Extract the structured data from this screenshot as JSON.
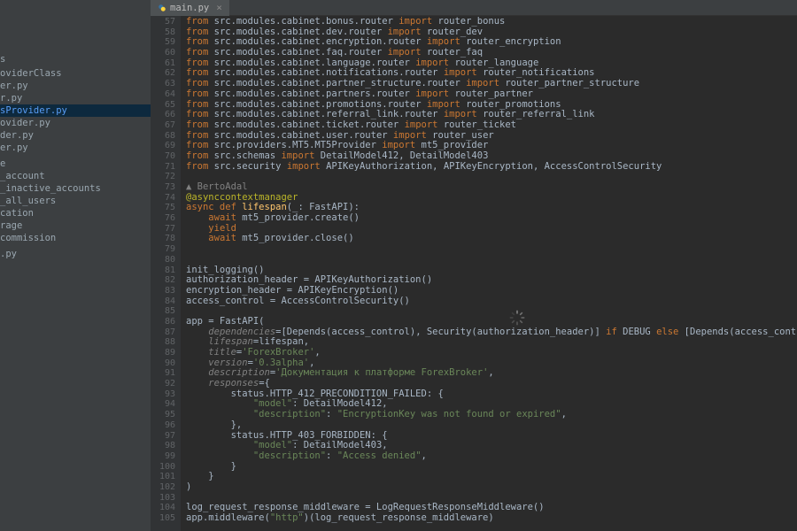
{
  "tab": {
    "filename": "main.py",
    "icon": "python-icon"
  },
  "sidebar": {
    "items": [
      "s",
      "",
      "oviderClass",
      "er.py",
      "r.py",
      "sProvider.py",
      "ovider.py",
      "der.py",
      "er.py",
      "",
      "",
      "e",
      "_account",
      "_inactive_accounts",
      "_all_users",
      "cation",
      "rage",
      "commission",
      "",
      "",
      ".py"
    ],
    "selected_index": 5
  },
  "gutter": {
    "start": 57,
    "end": 105,
    "fold_markers": [
      76,
      87,
      92,
      93,
      97
    ]
  },
  "author_hint": "BertoAdal",
  "code_lines": [
    {
      "n": 57,
      "pre": "",
      "t": [
        [
          "kw",
          "from"
        ],
        [
          "",
          " src.modules.cabinet.bonus.router "
        ],
        [
          "kw",
          "import"
        ],
        [
          "",
          " router_bonus"
        ]
      ]
    },
    {
      "n": 58,
      "pre": "",
      "t": [
        [
          "kw",
          "from"
        ],
        [
          "",
          " src.modules.cabinet.dev.router "
        ],
        [
          "kw",
          "import"
        ],
        [
          "",
          " router_dev"
        ]
      ]
    },
    {
      "n": 59,
      "pre": "",
      "t": [
        [
          "kw",
          "from"
        ],
        [
          "",
          " src.modules.cabinet.encryption.router "
        ],
        [
          "kw",
          "import"
        ],
        [
          "",
          " router_encryption"
        ]
      ]
    },
    {
      "n": 60,
      "pre": "",
      "t": [
        [
          "kw",
          "from"
        ],
        [
          "",
          " src.modules.cabinet.faq.router "
        ],
        [
          "kw",
          "import"
        ],
        [
          "",
          " router_faq"
        ]
      ]
    },
    {
      "n": 61,
      "pre": "",
      "t": [
        [
          "kw",
          "from"
        ],
        [
          "",
          " src.modules.cabinet.language.router "
        ],
        [
          "kw",
          "import"
        ],
        [
          "",
          " router_language"
        ]
      ]
    },
    {
      "n": 62,
      "pre": "",
      "t": [
        [
          "kw",
          "from"
        ],
        [
          "",
          " src.modules.cabinet.notifications.router "
        ],
        [
          "kw",
          "import"
        ],
        [
          "",
          " router_notifications"
        ]
      ]
    },
    {
      "n": 63,
      "pre": "",
      "t": [
        [
          "kw",
          "from"
        ],
        [
          "",
          " src.modules.cabinet.partner_structure.router "
        ],
        [
          "kw",
          "import"
        ],
        [
          "",
          " router_partner_structure"
        ]
      ]
    },
    {
      "n": 64,
      "pre": "",
      "t": [
        [
          "kw",
          "from"
        ],
        [
          "",
          " src.modules.cabinet.partners.router "
        ],
        [
          "kw",
          "import"
        ],
        [
          "",
          " router_partner"
        ]
      ]
    },
    {
      "n": 65,
      "pre": "",
      "t": [
        [
          "kw",
          "from"
        ],
        [
          "",
          " src.modules.cabinet.promotions.router "
        ],
        [
          "kw",
          "import"
        ],
        [
          "",
          " router_promotions"
        ]
      ]
    },
    {
      "n": 66,
      "pre": "",
      "t": [
        [
          "kw",
          "from"
        ],
        [
          "",
          " src.modules.cabinet.referral_link.router "
        ],
        [
          "kw",
          "import"
        ],
        [
          "",
          " router_referral_link"
        ]
      ]
    },
    {
      "n": 67,
      "pre": "",
      "t": [
        [
          "kw",
          "from"
        ],
        [
          "",
          " src.modules.cabinet.ticket.router "
        ],
        [
          "kw",
          "import"
        ],
        [
          "",
          " router_ticket"
        ]
      ]
    },
    {
      "n": 68,
      "pre": "",
      "t": [
        [
          "kw",
          "from"
        ],
        [
          "",
          " src.modules.cabinet.user.router "
        ],
        [
          "kw",
          "import"
        ],
        [
          "",
          " router_user"
        ]
      ]
    },
    {
      "n": 69,
      "pre": "",
      "t": [
        [
          "kw",
          "from"
        ],
        [
          "",
          " src.providers.MT5.MT5Provider "
        ],
        [
          "kw",
          "import"
        ],
        [
          "",
          " mt5_provider"
        ]
      ]
    },
    {
      "n": 70,
      "pre": "",
      "t": [
        [
          "kw",
          "from"
        ],
        [
          "",
          " src.schemas "
        ],
        [
          "kw",
          "import"
        ],
        [
          "",
          " DetailModel412, DetailModel403"
        ]
      ]
    },
    {
      "n": 71,
      "pre": "",
      "t": [
        [
          "kw",
          "from"
        ],
        [
          "",
          " src.security "
        ],
        [
          "kw",
          "import"
        ],
        [
          "",
          " APIKeyAuthorization, APIKeyEncryption, AccessControlSecurity"
        ]
      ]
    },
    {
      "n": 72,
      "pre": "",
      "t": [
        [
          "",
          ""
        ]
      ]
    },
    {
      "n": 73,
      "pre": "",
      "t": [
        [
          "",
          ""
        ]
      ],
      "author": true
    },
    {
      "n": 74,
      "pre": "",
      "t": [
        [
          "annot",
          "@asynccontextmanager"
        ]
      ]
    },
    {
      "n": 75,
      "pre": "",
      "t": [
        [
          "kw",
          "async def "
        ],
        [
          "fn",
          "lifespan"
        ],
        [
          "",
          "(_: FastAPI):"
        ]
      ]
    },
    {
      "n": 76,
      "pre": "    ",
      "t": [
        [
          "kw",
          "await"
        ],
        [
          "",
          " mt5_provider.create()"
        ]
      ]
    },
    {
      "n": 77,
      "pre": "    ",
      "t": [
        [
          "kw",
          "yield"
        ]
      ]
    },
    {
      "n": 78,
      "pre": "    ",
      "t": [
        [
          "kw",
          "await"
        ],
        [
          "",
          " mt5_provider.close()"
        ]
      ]
    },
    {
      "n": 79,
      "pre": "",
      "t": [
        [
          "",
          ""
        ]
      ]
    },
    {
      "n": 80,
      "pre": "",
      "t": [
        [
          "",
          ""
        ]
      ]
    },
    {
      "n": 81,
      "pre": "",
      "t": [
        [
          "",
          "init_logging()"
        ]
      ]
    },
    {
      "n": 82,
      "pre": "",
      "t": [
        [
          "",
          "authorization_header = APIKeyAuthorization()"
        ]
      ]
    },
    {
      "n": 83,
      "pre": "",
      "t": [
        [
          "",
          "encryption_header = APIKeyEncryption()"
        ]
      ]
    },
    {
      "n": 84,
      "pre": "",
      "t": [
        [
          "",
          "access_control = AccessControlSecurity()"
        ]
      ]
    },
    {
      "n": 85,
      "pre": "",
      "t": [
        [
          "",
          ""
        ]
      ]
    },
    {
      "n": 86,
      "pre": "",
      "t": [
        [
          "",
          "app = FastAPI("
        ]
      ]
    },
    {
      "n": 87,
      "pre": "    ",
      "t": [
        [
          "param",
          "dependencies"
        ],
        [
          "",
          "=[Depends(access_control), Security(authorization_header)] "
        ],
        [
          "kw",
          "if"
        ],
        [
          "",
          " DEBUG "
        ],
        [
          "kw",
          "else"
        ],
        [
          "",
          " [Depends(access_control), Security(authorization_header), Security(encryp"
        ]
      ]
    },
    {
      "n": 88,
      "pre": "    ",
      "t": [
        [
          "param",
          "lifespan"
        ],
        [
          "",
          "=lifespan,"
        ]
      ]
    },
    {
      "n": 89,
      "pre": "    ",
      "t": [
        [
          "param",
          "title"
        ],
        [
          "",
          "="
        ],
        [
          "str",
          "'ForexBroker'"
        ],
        [
          "",
          ","
        ]
      ]
    },
    {
      "n": 90,
      "pre": "    ",
      "t": [
        [
          "param",
          "version"
        ],
        [
          "",
          "="
        ],
        [
          "str",
          "'0.3alpha'"
        ],
        [
          "",
          ","
        ]
      ]
    },
    {
      "n": 91,
      "pre": "    ",
      "t": [
        [
          "param",
          "description"
        ],
        [
          "",
          "="
        ],
        [
          "str",
          "'Документация к платформе ForexBroker'"
        ],
        [
          "",
          ","
        ]
      ]
    },
    {
      "n": 92,
      "pre": "    ",
      "t": [
        [
          "param",
          "responses"
        ],
        [
          "",
          "={"
        ]
      ]
    },
    {
      "n": 93,
      "pre": "        ",
      "t": [
        [
          "",
          "status.HTTP_412_PRECONDITION_FAILED: {"
        ]
      ]
    },
    {
      "n": 94,
      "pre": "            ",
      "t": [
        [
          "str",
          "\"model\""
        ],
        [
          "",
          ": DetailModel412,"
        ]
      ]
    },
    {
      "n": 95,
      "pre": "            ",
      "t": [
        [
          "str",
          "\"description\""
        ],
        [
          "",
          ": "
        ],
        [
          "str",
          "\"EncryptionKey was not found or expired\""
        ],
        [
          "",
          ","
        ]
      ]
    },
    {
      "n": 96,
      "pre": "        ",
      "t": [
        [
          "",
          "},"
        ]
      ]
    },
    {
      "n": 97,
      "pre": "        ",
      "t": [
        [
          "",
          "status.HTTP_403_FORBIDDEN: {"
        ]
      ]
    },
    {
      "n": 98,
      "pre": "            ",
      "t": [
        [
          "str",
          "\"model\""
        ],
        [
          "",
          ": DetailModel403,"
        ]
      ]
    },
    {
      "n": 99,
      "pre": "            ",
      "t": [
        [
          "str",
          "\"description\""
        ],
        [
          "",
          ": "
        ],
        [
          "str",
          "\"Access denied\""
        ],
        [
          "",
          ","
        ]
      ]
    },
    {
      "n": 100,
      "pre": "        ",
      "t": [
        [
          "",
          "}"
        ]
      ]
    },
    {
      "n": 101,
      "pre": "    ",
      "t": [
        [
          "",
          "}"
        ]
      ]
    },
    {
      "n": 102,
      "pre": "",
      "t": [
        [
          "",
          ")"
        ]
      ]
    },
    {
      "n": 103,
      "pre": "",
      "t": [
        [
          "",
          ""
        ]
      ]
    },
    {
      "n": 104,
      "pre": "",
      "t": [
        [
          "",
          "log_request_response_middleware = LogRequestResponseMiddleware()"
        ]
      ]
    },
    {
      "n": 105,
      "pre": "",
      "t": [
        [
          "",
          "app.middleware("
        ],
        [
          "str",
          "\"http\""
        ],
        [
          "",
          ")(log_request_response_middleware)"
        ]
      ]
    }
  ]
}
